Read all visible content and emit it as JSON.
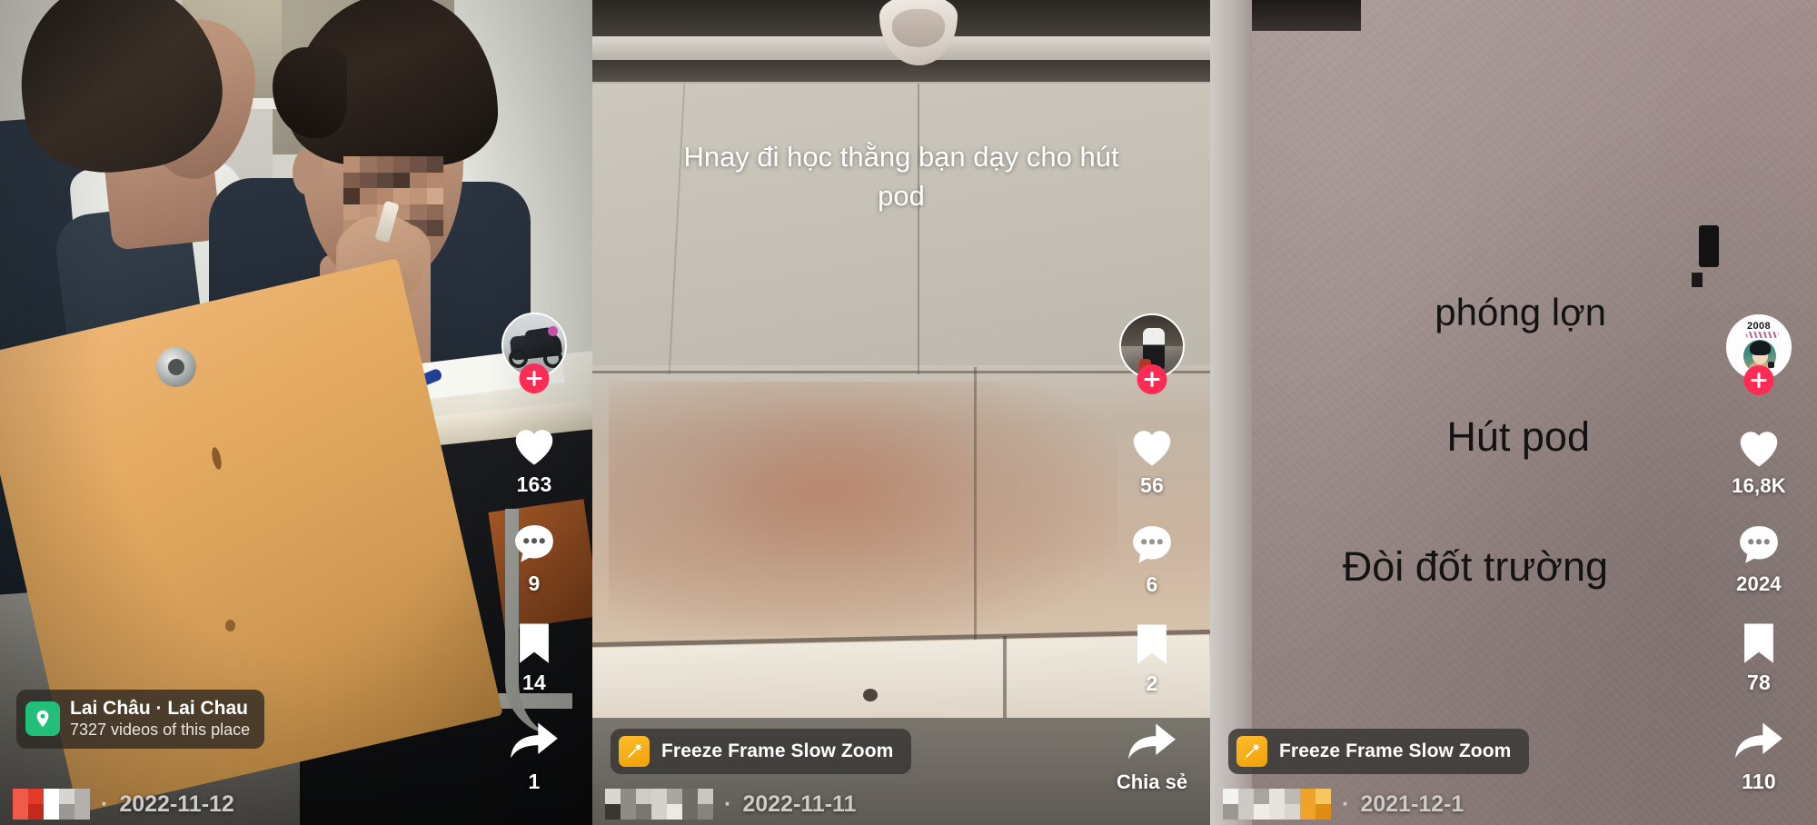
{
  "app": "tiktok-video-grid",
  "panels": [
    {
      "id": "panel-1",
      "scene_description": "Two male students sitting at a classroom desk; one has a pixelated face and holds a vape pod to his mouth",
      "overlay_text": [],
      "location_badge": {
        "name": "Lai Châu · Lai Chau",
        "subtitle": "7327 videos of this place",
        "icon": "location-pin-icon",
        "icon_color": "#22BF7B"
      },
      "effect_badge": null,
      "author": {
        "name_masked": true,
        "date": "2022-11-12",
        "separator": "·"
      },
      "sidebar": {
        "avatar": {
          "image": "motorbike-avatar",
          "follow_label": "+"
        },
        "like": {
          "icon": "heart-icon",
          "count": "163"
        },
        "comment": {
          "icon": "comment-icon",
          "count": "9"
        },
        "bookmark": {
          "icon": "bookmark-icon",
          "count": "14"
        },
        "share": {
          "icon": "share-arrow-icon",
          "count": "1"
        }
      }
    },
    {
      "id": "panel-2",
      "scene_description": "Tiled school corridor floor with a white shoe entering at top of frame",
      "overlay_text": [
        "Hnay đi học thằng bạn dạy cho hút",
        "pod"
      ],
      "location_badge": null,
      "effect_badge": {
        "label": "Freeze Frame Slow Zoom",
        "icon": "magic-wand-icon",
        "icon_color": "#F5AE12"
      },
      "author": {
        "name_masked": true,
        "date": "2022-11-11",
        "separator": "·"
      },
      "sidebar": {
        "avatar": {
          "image": "street-person-avatar",
          "follow_label": "+"
        },
        "like": {
          "icon": "heart-icon",
          "count": "56"
        },
        "comment": {
          "icon": "comment-icon",
          "count": "6"
        },
        "bookmark": {
          "icon": "bookmark-icon",
          "count": "2"
        },
        "share": {
          "icon": "share-arrow-icon",
          "count": "Chia sẻ"
        }
      }
    },
    {
      "id": "panel-3",
      "scene_description": "Plain mauve / taupe textured wall with black caption text lines",
      "overlay_text": [
        "phóng lợn",
        "Hút pod",
        "Đòi đốt trường"
      ],
      "location_badge": null,
      "effect_badge": {
        "label": "Freeze Frame Slow Zoom",
        "icon": "magic-wand-icon",
        "icon_color": "#F5AE12"
      },
      "author": {
        "name_masked": true,
        "date": "2021-12-1",
        "separator": "·"
      },
      "sidebar": {
        "avatar": {
          "image": "anime-2008-avatar",
          "avatar_year": "2008",
          "follow_label": "+"
        },
        "like": {
          "icon": "heart-icon",
          "count": "16,8K"
        },
        "comment": {
          "icon": "comment-icon",
          "count": "2024"
        },
        "bookmark": {
          "icon": "bookmark-icon",
          "count": "78"
        },
        "share": {
          "icon": "share-arrow-icon",
          "count": "110"
        }
      }
    }
  ],
  "colors": {
    "accent_pink": "#FE2C55",
    "badge_bg": "rgba(44,38,34,.78)",
    "effect_yellow": "#F5AE12",
    "location_green": "#22BF7B",
    "text_white": "#ffffff"
  }
}
